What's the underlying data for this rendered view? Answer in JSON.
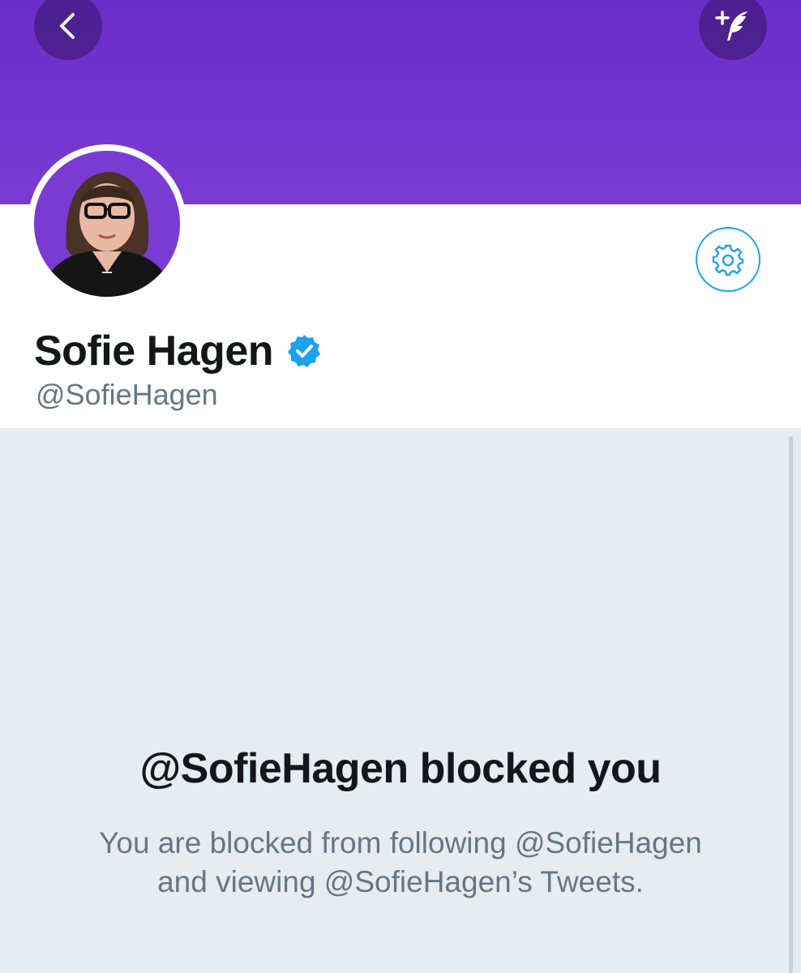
{
  "nav": {
    "back_icon": "chevron-left-icon",
    "compose_icon": "compose-feather-icon"
  },
  "profile": {
    "display_name": "Sofie Hagen",
    "handle": "@SofieHagen",
    "verified_icon": "verified-badge-icon",
    "settings_icon": "gear-icon"
  },
  "blocked": {
    "title": "@SofieHagen blocked you",
    "description": "You are blocked from following @SofieHagen and viewing @SofieHagen’s Tweets."
  },
  "colors": {
    "banner": "#7335cf",
    "accent": "#1da1f2",
    "text_primary": "#14171a",
    "text_secondary": "#657786",
    "background": "#e6ecf0"
  }
}
